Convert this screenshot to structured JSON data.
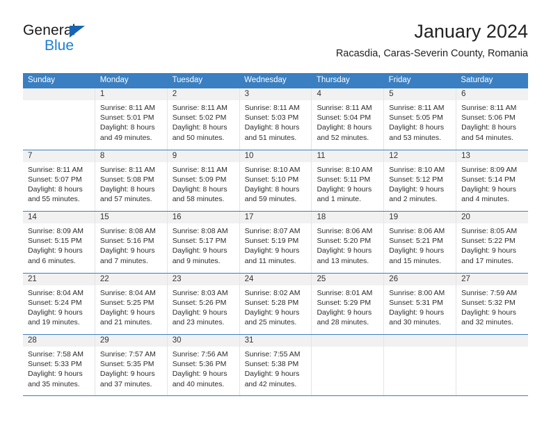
{
  "brand": {
    "name_dark": "General",
    "name_blue": "Blue",
    "triangle_color": "#1665b5",
    "blue_color": "#1b7fd4"
  },
  "header": {
    "title": "January 2024",
    "subtitle": "Racasdia, Caras-Severin County, Romania"
  },
  "theme": {
    "header_bg": "#3a7fc1",
    "daynum_bg": "#f1f1f1",
    "grid_line": "#e4e4e4"
  },
  "weekdays": [
    "Sunday",
    "Monday",
    "Tuesday",
    "Wednesday",
    "Thursday",
    "Friday",
    "Saturday"
  ],
  "weeks": [
    [
      {
        "day": "",
        "empty": true,
        "sunrise": "",
        "sunset": "",
        "daylight1": "",
        "daylight2": ""
      },
      {
        "day": "1",
        "sunrise": "Sunrise: 8:11 AM",
        "sunset": "Sunset: 5:01 PM",
        "daylight1": "Daylight: 8 hours",
        "daylight2": "and 49 minutes."
      },
      {
        "day": "2",
        "sunrise": "Sunrise: 8:11 AM",
        "sunset": "Sunset: 5:02 PM",
        "daylight1": "Daylight: 8 hours",
        "daylight2": "and 50 minutes."
      },
      {
        "day": "3",
        "sunrise": "Sunrise: 8:11 AM",
        "sunset": "Sunset: 5:03 PM",
        "daylight1": "Daylight: 8 hours",
        "daylight2": "and 51 minutes."
      },
      {
        "day": "4",
        "sunrise": "Sunrise: 8:11 AM",
        "sunset": "Sunset: 5:04 PM",
        "daylight1": "Daylight: 8 hours",
        "daylight2": "and 52 minutes."
      },
      {
        "day": "5",
        "sunrise": "Sunrise: 8:11 AM",
        "sunset": "Sunset: 5:05 PM",
        "daylight1": "Daylight: 8 hours",
        "daylight2": "and 53 minutes."
      },
      {
        "day": "6",
        "sunrise": "Sunrise: 8:11 AM",
        "sunset": "Sunset: 5:06 PM",
        "daylight1": "Daylight: 8 hours",
        "daylight2": "and 54 minutes."
      }
    ],
    [
      {
        "day": "7",
        "sunrise": "Sunrise: 8:11 AM",
        "sunset": "Sunset: 5:07 PM",
        "daylight1": "Daylight: 8 hours",
        "daylight2": "and 55 minutes."
      },
      {
        "day": "8",
        "sunrise": "Sunrise: 8:11 AM",
        "sunset": "Sunset: 5:08 PM",
        "daylight1": "Daylight: 8 hours",
        "daylight2": "and 57 minutes."
      },
      {
        "day": "9",
        "sunrise": "Sunrise: 8:11 AM",
        "sunset": "Sunset: 5:09 PM",
        "daylight1": "Daylight: 8 hours",
        "daylight2": "and 58 minutes."
      },
      {
        "day": "10",
        "sunrise": "Sunrise: 8:10 AM",
        "sunset": "Sunset: 5:10 PM",
        "daylight1": "Daylight: 8 hours",
        "daylight2": "and 59 minutes."
      },
      {
        "day": "11",
        "sunrise": "Sunrise: 8:10 AM",
        "sunset": "Sunset: 5:11 PM",
        "daylight1": "Daylight: 9 hours",
        "daylight2": "and 1 minute."
      },
      {
        "day": "12",
        "sunrise": "Sunrise: 8:10 AM",
        "sunset": "Sunset: 5:12 PM",
        "daylight1": "Daylight: 9 hours",
        "daylight2": "and 2 minutes."
      },
      {
        "day": "13",
        "sunrise": "Sunrise: 8:09 AM",
        "sunset": "Sunset: 5:14 PM",
        "daylight1": "Daylight: 9 hours",
        "daylight2": "and 4 minutes."
      }
    ],
    [
      {
        "day": "14",
        "sunrise": "Sunrise: 8:09 AM",
        "sunset": "Sunset: 5:15 PM",
        "daylight1": "Daylight: 9 hours",
        "daylight2": "and 6 minutes."
      },
      {
        "day": "15",
        "sunrise": "Sunrise: 8:08 AM",
        "sunset": "Sunset: 5:16 PM",
        "daylight1": "Daylight: 9 hours",
        "daylight2": "and 7 minutes."
      },
      {
        "day": "16",
        "sunrise": "Sunrise: 8:08 AM",
        "sunset": "Sunset: 5:17 PM",
        "daylight1": "Daylight: 9 hours",
        "daylight2": "and 9 minutes."
      },
      {
        "day": "17",
        "sunrise": "Sunrise: 8:07 AM",
        "sunset": "Sunset: 5:19 PM",
        "daylight1": "Daylight: 9 hours",
        "daylight2": "and 11 minutes."
      },
      {
        "day": "18",
        "sunrise": "Sunrise: 8:06 AM",
        "sunset": "Sunset: 5:20 PM",
        "daylight1": "Daylight: 9 hours",
        "daylight2": "and 13 minutes."
      },
      {
        "day": "19",
        "sunrise": "Sunrise: 8:06 AM",
        "sunset": "Sunset: 5:21 PM",
        "daylight1": "Daylight: 9 hours",
        "daylight2": "and 15 minutes."
      },
      {
        "day": "20",
        "sunrise": "Sunrise: 8:05 AM",
        "sunset": "Sunset: 5:22 PM",
        "daylight1": "Daylight: 9 hours",
        "daylight2": "and 17 minutes."
      }
    ],
    [
      {
        "day": "21",
        "sunrise": "Sunrise: 8:04 AM",
        "sunset": "Sunset: 5:24 PM",
        "daylight1": "Daylight: 9 hours",
        "daylight2": "and 19 minutes."
      },
      {
        "day": "22",
        "sunrise": "Sunrise: 8:04 AM",
        "sunset": "Sunset: 5:25 PM",
        "daylight1": "Daylight: 9 hours",
        "daylight2": "and 21 minutes."
      },
      {
        "day": "23",
        "sunrise": "Sunrise: 8:03 AM",
        "sunset": "Sunset: 5:26 PM",
        "daylight1": "Daylight: 9 hours",
        "daylight2": "and 23 minutes."
      },
      {
        "day": "24",
        "sunrise": "Sunrise: 8:02 AM",
        "sunset": "Sunset: 5:28 PM",
        "daylight1": "Daylight: 9 hours",
        "daylight2": "and 25 minutes."
      },
      {
        "day": "25",
        "sunrise": "Sunrise: 8:01 AM",
        "sunset": "Sunset: 5:29 PM",
        "daylight1": "Daylight: 9 hours",
        "daylight2": "and 28 minutes."
      },
      {
        "day": "26",
        "sunrise": "Sunrise: 8:00 AM",
        "sunset": "Sunset: 5:31 PM",
        "daylight1": "Daylight: 9 hours",
        "daylight2": "and 30 minutes."
      },
      {
        "day": "27",
        "sunrise": "Sunrise: 7:59 AM",
        "sunset": "Sunset: 5:32 PM",
        "daylight1": "Daylight: 9 hours",
        "daylight2": "and 32 minutes."
      }
    ],
    [
      {
        "day": "28",
        "sunrise": "Sunrise: 7:58 AM",
        "sunset": "Sunset: 5:33 PM",
        "daylight1": "Daylight: 9 hours",
        "daylight2": "and 35 minutes."
      },
      {
        "day": "29",
        "sunrise": "Sunrise: 7:57 AM",
        "sunset": "Sunset: 5:35 PM",
        "daylight1": "Daylight: 9 hours",
        "daylight2": "and 37 minutes."
      },
      {
        "day": "30",
        "sunrise": "Sunrise: 7:56 AM",
        "sunset": "Sunset: 5:36 PM",
        "daylight1": "Daylight: 9 hours",
        "daylight2": "and 40 minutes."
      },
      {
        "day": "31",
        "sunrise": "Sunrise: 7:55 AM",
        "sunset": "Sunset: 5:38 PM",
        "daylight1": "Daylight: 9 hours",
        "daylight2": "and 42 minutes."
      },
      {
        "day": "",
        "empty": true,
        "sunrise": "",
        "sunset": "",
        "daylight1": "",
        "daylight2": ""
      },
      {
        "day": "",
        "empty": true,
        "sunrise": "",
        "sunset": "",
        "daylight1": "",
        "daylight2": ""
      },
      {
        "day": "",
        "empty": true,
        "sunrise": "",
        "sunset": "",
        "daylight1": "",
        "daylight2": ""
      }
    ]
  ]
}
